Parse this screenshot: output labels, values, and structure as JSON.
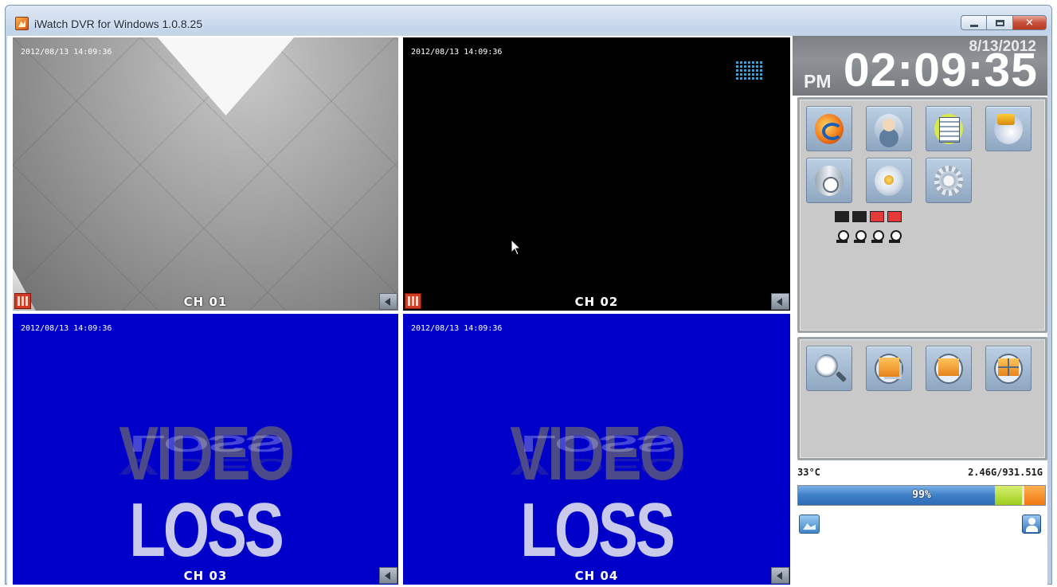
{
  "window": {
    "title": "iWatch DVR for Windows 1.0.8.25",
    "controls": {
      "minimize": "minimize",
      "maximize": "maximize",
      "close": "close"
    }
  },
  "channels": [
    {
      "label": "CH 01",
      "timestamp": "2012/08/13 14:09:36",
      "state": "live",
      "recording": true
    },
    {
      "label": "CH 02",
      "timestamp": "2012/08/13 14:09:36",
      "state": "live",
      "recording": true
    },
    {
      "label": "CH 03",
      "timestamp": "2012/08/13 14:09:36",
      "state": "video_loss",
      "loss_text": [
        "VIDEO",
        "LOSS"
      ]
    },
    {
      "label": "CH 04",
      "timestamp": "2012/08/13 14:09:36",
      "state": "video_loss",
      "loss_text": [
        "VIDEO",
        "LOSS"
      ]
    }
  ],
  "clock": {
    "date": "8/13/2012",
    "ampm": "PM",
    "time": "02:09:35"
  },
  "function_buttons": [
    {
      "name": "playback",
      "icon": "playback-icon"
    },
    {
      "name": "user",
      "icon": "user-icon"
    },
    {
      "name": "log",
      "icon": "log-icon"
    },
    {
      "name": "network",
      "icon": "network-icon"
    },
    {
      "name": "backup",
      "icon": "backup-icon"
    },
    {
      "name": "ptz",
      "icon": "ptz-icon"
    },
    {
      "name": "setup",
      "icon": "gear-icon"
    }
  ],
  "camera_status": [
    "ok",
    "ok",
    "alarm",
    "alarm"
  ],
  "view_buttons": [
    {
      "name": "search",
      "icon": "search-icon"
    },
    {
      "name": "layout-single",
      "icon": "layout-pip-icon"
    },
    {
      "name": "layout-full",
      "icon": "layout-single-icon"
    },
    {
      "name": "layout-quad",
      "icon": "layout-quad-icon"
    }
  ],
  "system": {
    "temperature": "33°C",
    "disk": "2.46G/931.51G",
    "usage_text": "99%",
    "usage_percent": 99
  },
  "colors": {
    "video_loss_bg": "#0000c8",
    "alarm_red": "#e43a3a",
    "usage_blue": "#3f7fc8"
  }
}
